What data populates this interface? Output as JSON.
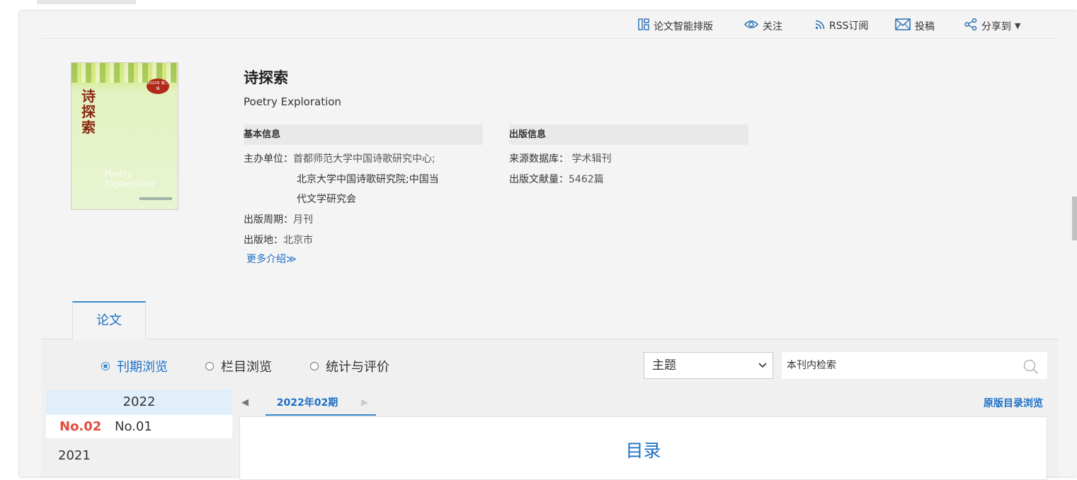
{
  "toolbar": {
    "items": [
      {
        "label": "论文智能排版",
        "icon": "layout-icon"
      },
      {
        "label": "关注",
        "icon": "eye-icon"
      },
      {
        "label": "RSS订阅",
        "icon": "rss-icon"
      },
      {
        "label": "投稿",
        "icon": "mail-icon"
      },
      {
        "label": "分享到",
        "icon": "share-icon",
        "suffix": "▼"
      }
    ]
  },
  "journal": {
    "title_cn": "诗探索",
    "title_en": "Poetry Exploration",
    "cover": {
      "title": "诗探索",
      "badge": "2022年 第二辑",
      "en_text": "Poetry Exploration"
    }
  },
  "basic_info": {
    "heading": "基本信息",
    "sponsor_label": "主办单位：",
    "sponsor_lines": [
      "首都师范大学中国诗歌研究中心;",
      "北京大学中国诗歌研究院;中国当",
      "代文学研究会"
    ],
    "period_label": "出版周期：",
    "period_value": "月刊",
    "place_label": "出版地：",
    "place_value": "北京市",
    "more_label": "更多介绍≫"
  },
  "pub_info": {
    "heading": "出版信息",
    "source_label": "来源数据库：",
    "source_value": "学术辑刊",
    "count_label": "出版文献量：",
    "count_value": "5462篇"
  },
  "tabs": {
    "papers": "论文"
  },
  "browse_modes": [
    {
      "label": "刊期浏览",
      "selected": true
    },
    {
      "label": "栏目浏览",
      "selected": false
    },
    {
      "label": "统计与评价",
      "selected": false
    }
  ],
  "search": {
    "field_select": "主题",
    "placeholder": "本刊内检索"
  },
  "years": {
    "current": "2022",
    "issues": [
      {
        "label": "No.02",
        "active": true
      },
      {
        "label": "No.01",
        "active": false
      }
    ],
    "previous": "2021"
  },
  "issue_nav": {
    "prev": "◀",
    "current": "2022年02期",
    "next": "▶",
    "orig_toc": "原版目录浏览"
  },
  "toc": {
    "title": "目录"
  },
  "colors": {
    "accent": "#1e6fc5",
    "active_issue": "#e34c3a",
    "year_highlight": "#e1effa"
  }
}
